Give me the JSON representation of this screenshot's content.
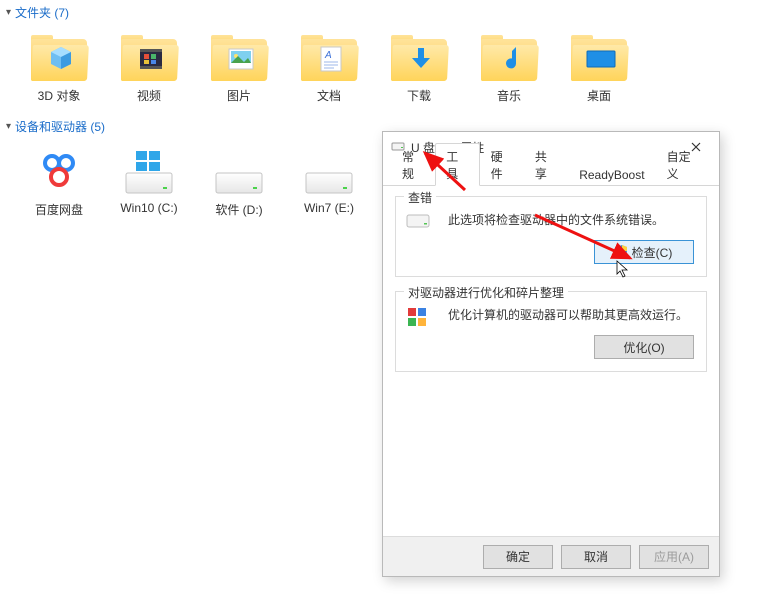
{
  "sections": {
    "folders": {
      "title": "文件夹 (7)"
    },
    "drives": {
      "title": "设备和驱动器 (5)"
    }
  },
  "folders": [
    {
      "label": "3D 对象",
      "inner": "cube3d"
    },
    {
      "label": "视频",
      "inner": "film"
    },
    {
      "label": "图片",
      "inner": "photo"
    },
    {
      "label": "文档",
      "inner": "doc"
    },
    {
      "label": "下载",
      "inner": "download"
    },
    {
      "label": "音乐",
      "inner": "note"
    },
    {
      "label": "桌面",
      "inner": "desktop"
    }
  ],
  "drives": [
    {
      "label": "百度网盘",
      "icon": "baidupan"
    },
    {
      "label": "Win10 (C:)",
      "icon": "win"
    },
    {
      "label": "软件 (D:)",
      "icon": "plain"
    },
    {
      "label": "Win7 (E:)",
      "icon": "plain"
    }
  ],
  "dialog": {
    "title": "U 盘 (F:) 属性",
    "tabs": [
      "常规",
      "工具",
      "硬件",
      "共享",
      "ReadyBoost",
      "自定义"
    ],
    "active_tab_index": 1,
    "group_check": {
      "title": "查错",
      "desc": "此选项将检查驱动器中的文件系统错误。",
      "button": "检查(C)"
    },
    "group_opt": {
      "title": "对驱动器进行优化和碎片整理",
      "desc": "优化计算机的驱动器可以帮助其更高效运行。",
      "button": "优化(O)"
    },
    "footer": {
      "ok": "确定",
      "cancel": "取消",
      "apply": "应用(A)"
    }
  }
}
